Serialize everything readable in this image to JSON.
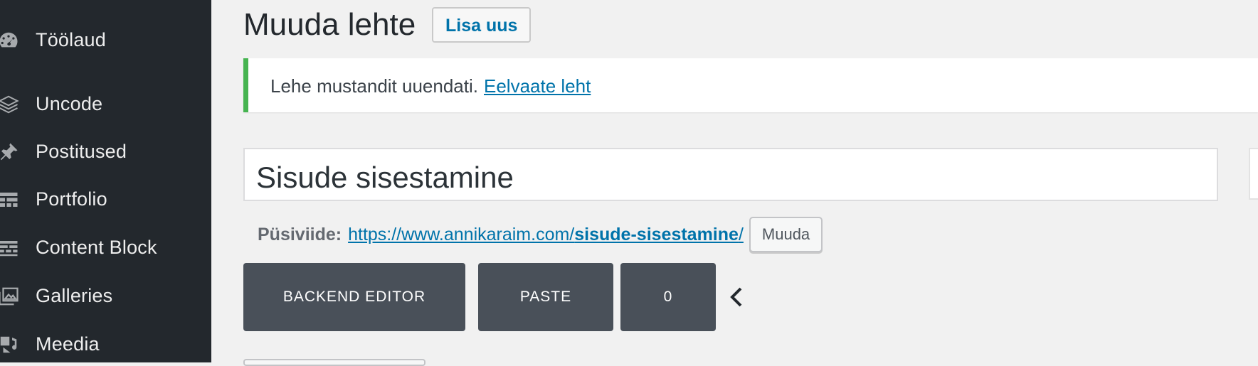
{
  "sidebar": {
    "items": [
      {
        "label": "Töölaud",
        "icon": "dashboard-icon"
      },
      {
        "label": "Uncode",
        "icon": "layers-icon"
      },
      {
        "label": "Postitused",
        "icon": "pin-icon"
      },
      {
        "label": "Portfolio",
        "icon": "portfolio-icon"
      },
      {
        "label": "Content Block",
        "icon": "content-block-icon"
      },
      {
        "label": "Galleries",
        "icon": "gallery-icon"
      },
      {
        "label": "Meedia",
        "icon": "media-icon"
      }
    ]
  },
  "header": {
    "title": "Muuda lehte",
    "add_new": "Lisa uus"
  },
  "notice": {
    "text": "Lehe mustandit uuendati.",
    "link": "Eelvaate leht",
    "color": "#46b450"
  },
  "post": {
    "title": "Sisude sisestamine"
  },
  "permalink": {
    "label": "Püsiviide:",
    "url_base": "https://www.annikaraim.com/",
    "slug": "sisude-sisestamine",
    "trailing": "/",
    "edit_label": "Muuda"
  },
  "editor": {
    "backend_label": "BACKEND EDITOR",
    "paste_label": "PASTE",
    "count_label": "0"
  },
  "colors": {
    "sidebar_bg": "#23282d",
    "link": "#0073aa",
    "button_bg": "#495059"
  }
}
